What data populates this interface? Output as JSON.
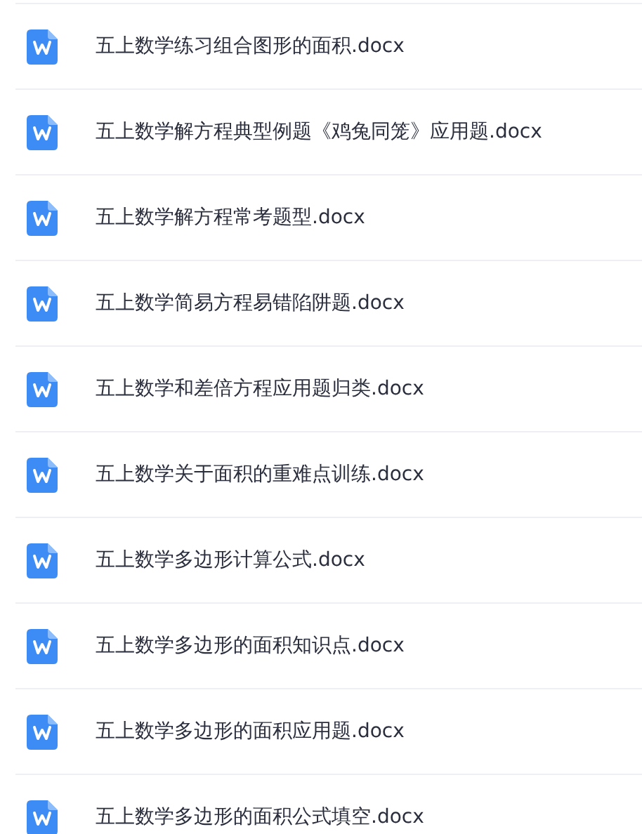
{
  "files": [
    {
      "name": "五上数学练习组合图形的面积.docx"
    },
    {
      "name": "五上数学解方程典型例题《鸡兔同笼》应用题.docx"
    },
    {
      "name": "五上数学解方程常考题型.docx"
    },
    {
      "name": "五上数学简易方程易错陷阱题.docx"
    },
    {
      "name": "五上数学和差倍方程应用题归类.docx"
    },
    {
      "name": "五上数学关于面积的重难点训练.docx"
    },
    {
      "name": "五上数学多边形计算公式.docx"
    },
    {
      "name": "五上数学多边形的面积知识点.docx"
    },
    {
      "name": "五上数学多边形的面积应用题.docx"
    },
    {
      "name": "五上数学多边形的面积公式填空.docx"
    }
  ]
}
